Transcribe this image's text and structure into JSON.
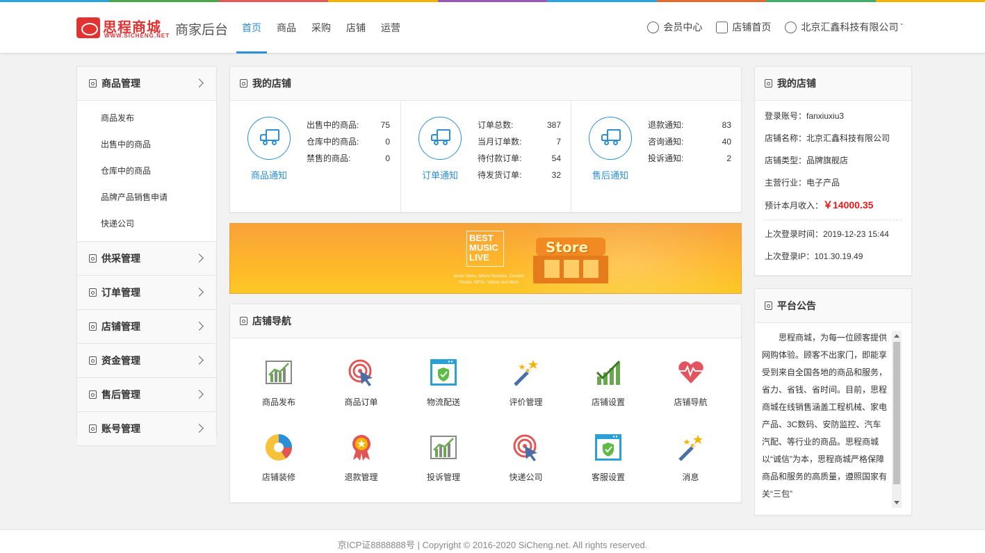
{
  "stripe_colors": [
    "#2aa5e0",
    "#4aa84a",
    "#e85a5a",
    "#f4b400",
    "#9b59b6",
    "#2aa5e0",
    "#e56a2d",
    "#3fb06a",
    "#f4b400"
  ],
  "accent": "#2a8fd6",
  "header": {
    "logo_brand": "思程商城",
    "logo_url": "WWW.SICHENG.NET",
    "subtitle": "商家后台",
    "nav": [
      "首页",
      "商品",
      "采购",
      "店铺",
      "运营"
    ],
    "active_nav": 0,
    "member_center": "会员中心",
    "store_home": "店铺首页",
    "company": "北京汇鑫科技有限公司"
  },
  "sidebar": {
    "groups": [
      {
        "label": "商品管理",
        "sub": [
          "商品发布",
          "出售中的商品",
          "仓库中的商品",
          "品牌产品销售申请",
          "快递公司"
        ]
      },
      {
        "label": "供采管理"
      },
      {
        "label": "订单管理"
      },
      {
        "label": "店铺管理"
      },
      {
        "label": "资金管理"
      },
      {
        "label": "售后管理"
      },
      {
        "label": "账号管理"
      }
    ]
  },
  "shop": {
    "title": "我的店铺",
    "stats": [
      {
        "label": "商品通知",
        "rows": [
          {
            "k": "出售中的商品:",
            "v": "75"
          },
          {
            "k": "仓库中的商品:",
            "v": "0"
          },
          {
            "k": "禁售的商品:",
            "v": "0"
          }
        ]
      },
      {
        "label": "订单通知",
        "rows": [
          {
            "k": "订单总数:",
            "v": "387"
          },
          {
            "k": "当月订单数:",
            "v": "7"
          },
          {
            "k": "待付款订单:",
            "v": "54"
          },
          {
            "k": "待发货订单:",
            "v": "32"
          }
        ]
      },
      {
        "label": "售后通知",
        "rows": [
          {
            "k": "退款通知:",
            "v": "83"
          },
          {
            "k": "咨询通知:",
            "v": "40"
          },
          {
            "k": "投诉通知:",
            "v": "2"
          }
        ]
      }
    ]
  },
  "banner": {
    "lines": [
      "BEST",
      "MUSIC",
      "LIVE"
    ],
    "small": "Music News, Album Reviews, Concert Photos, MP3s, Videos and More",
    "store": "Store"
  },
  "shop_nav": {
    "title": "店铺导航",
    "items": [
      {
        "label": "商品发布",
        "icon": "bar-chart-icon"
      },
      {
        "label": "商品订单",
        "icon": "target-cursor-icon"
      },
      {
        "label": "物流配送",
        "icon": "browser-shield-icon"
      },
      {
        "label": "评价管理",
        "icon": "magic-wand-icon"
      },
      {
        "label": "店铺设置",
        "icon": "growth-check-icon"
      },
      {
        "label": "店铺导航",
        "icon": "heart-pulse-icon"
      },
      {
        "label": "店铺装修",
        "icon": "donut-chart-icon"
      },
      {
        "label": "退款管理",
        "icon": "award-ribbon-icon"
      },
      {
        "label": "投诉管理",
        "icon": "bar-chart-icon"
      },
      {
        "label": "快递公司",
        "icon": "target-cursor-icon"
      },
      {
        "label": "客服设置",
        "icon": "browser-shield-icon"
      },
      {
        "label": "消息",
        "icon": "magic-wand-icon"
      }
    ]
  },
  "info": {
    "title": "我的店铺",
    "account": "登录账号：fanxiuxiu3",
    "store_name": "店铺名称：北京汇鑫科技有限公司",
    "store_type": "店铺类型：品牌旗舰店",
    "industry": "主营行业：电子产品",
    "income_label": "预计本月收入：",
    "income_value": "￥14000.35",
    "last_login_time": "上次登录时间：2019-12-23 15:44",
    "last_login_ip": "上次登录IP：101.30.19.49"
  },
  "notice": {
    "title": "平台公告",
    "text": "思程商城，为每一位顾客提供网购体验。顾客不出家门，即能享受到来自全国各地的商品和服务，省力、省钱、省时间。目前，思程商城在线销售涵盖工程机械、家电产品、3C数码、安防监控、汽车汽配、等行业的商品。思程商城以“诚信”为本，思程商城严格保障商品和服务的高质量，遵照国家有关“三包”"
  },
  "footer": "京ICP证8888888号 | Copyright © 2016-2020 SiCheng.net. All rights reserved."
}
